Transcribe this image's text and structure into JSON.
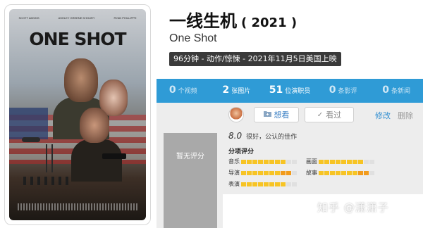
{
  "poster": {
    "title_text": "ONE SHOT",
    "actors": [
      "SCOTT ADKINS",
      "ASHLEY GREENE KHOURY",
      "RYAN PHILLIPPE"
    ]
  },
  "header": {
    "title": "一线生机",
    "year": "( 2021 )",
    "subtitle": "One Shot",
    "meta": "96分钟 - 动作/惊悚 - 2021年11月5日美国上映"
  },
  "stats": [
    {
      "num": "0",
      "label": "个视频",
      "active": false
    },
    {
      "num": "2",
      "label": "张图片",
      "active": true
    },
    {
      "num": "51",
      "label": "位演职员",
      "active": true
    },
    {
      "num": "0",
      "label": "条影评",
      "active": false
    },
    {
      "num": "0",
      "label": "条新闻",
      "active": false
    }
  ],
  "actions": {
    "want_label": "想看",
    "seen_label": "看过",
    "edit_label": "修改",
    "delete_label": "删除"
  },
  "score_box": {
    "label": "暂无评分"
  },
  "rating": {
    "score": "8.0",
    "text": "很好，公认的佳作"
  },
  "sub_ratings": {
    "title": "分项评分",
    "items": [
      {
        "label": "音乐",
        "value": 8
      },
      {
        "label": "画面",
        "value": 8
      },
      {
        "label": "导演",
        "value": 9
      },
      {
        "label": "故事",
        "value": 9
      },
      {
        "label": "表演",
        "value": 8
      }
    ],
    "max": 10
  },
  "watermark": "知乎 @潇潇子",
  "colors": {
    "stats_bar": "#2f9bd6",
    "rating_bar": "#f7c424",
    "rating_bar_high": "#f29b1c",
    "accent_link": "#2f8dd0"
  }
}
